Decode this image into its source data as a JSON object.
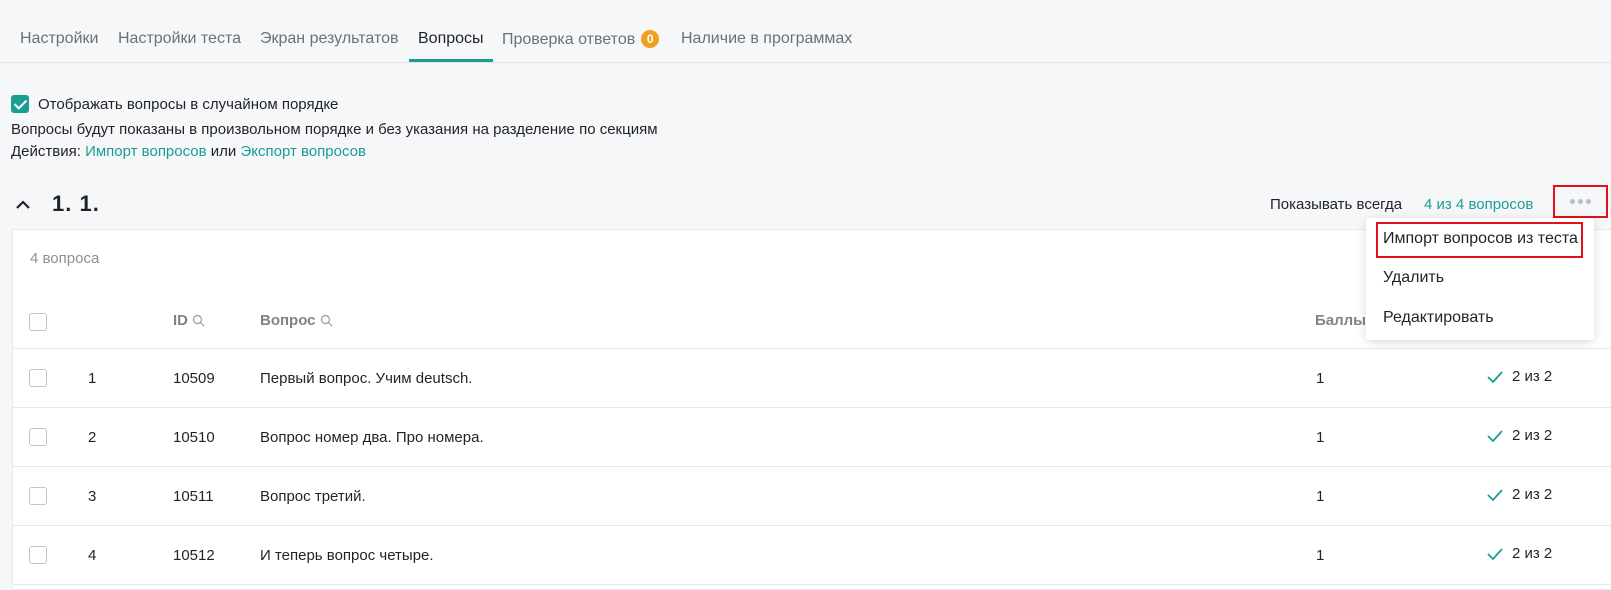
{
  "tabs": [
    {
      "label": "Настройки"
    },
    {
      "label": "Настройки теста"
    },
    {
      "label": "Экран результатов"
    },
    {
      "label": "Вопросы"
    },
    {
      "label": "Проверка ответов",
      "badge": "0"
    },
    {
      "label": "Наличие в программах"
    }
  ],
  "options": {
    "random_order_label": "Отображать вопросы в случайном порядке",
    "random_order_checked": true,
    "description": "Вопросы будут показаны в произвольном порядке и без указания на разделение по секциям",
    "actions_prefix": "Действия:",
    "import_link": "Импорт вопросов",
    "or_text": "или",
    "export_link": "Экспорт вопросов"
  },
  "section": {
    "title": "1. 1.",
    "show_mode": "Показывать всегда",
    "count_link": "4 из 4 вопросов",
    "question_count": "4 вопроса",
    "columns": {
      "id": "ID",
      "question": "Вопрос",
      "score": "Баллы"
    },
    "rows": [
      {
        "num": "1",
        "id": "10509",
        "question": "Первый вопрос. Учим deutsch.",
        "score": "1",
        "status": "2 из 2"
      },
      {
        "num": "2",
        "id": "10510",
        "question": "Вопрос номер два. Про номера.",
        "score": "1",
        "status": "2 из 2"
      },
      {
        "num": "3",
        "id": "10511",
        "question": "Вопрос третий.",
        "score": "1",
        "status": "2 из 2"
      },
      {
        "num": "4",
        "id": "10512",
        "question": "И теперь вопрос четыре.",
        "score": "1",
        "status": "2 из 2"
      }
    ]
  },
  "menu": {
    "items": [
      "Импорт вопросов из теста",
      "Удалить",
      "Редактировать"
    ]
  },
  "colors": {
    "accent": "#1a9e94",
    "badge": "#f0a020",
    "highlight": "#e0111b"
  }
}
